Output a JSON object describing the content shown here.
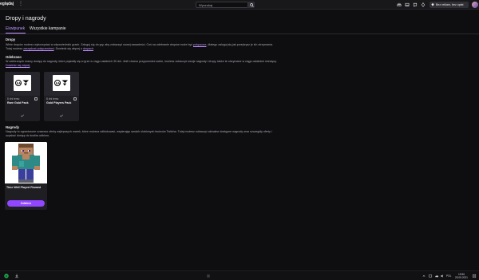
{
  "topbar": {
    "brand": "eglądaj",
    "more_symbol": "⋮",
    "search_placeholder": "Wyszukaj",
    "turbo_label": "Bez reklam, bez opłat"
  },
  "page": {
    "title": "Dropy i nagrody",
    "tabs": [
      {
        "label": "Ekwipunek",
        "active": true
      },
      {
        "label": "Wszystkie kampanie",
        "active": false
      }
    ]
  },
  "drops": {
    "title": "Dropy",
    "text1": "Wiele dropów możesz wykorzystać w odpowiednich grach. Zaloguj się do gry, aby zobaczyć nowej zawartości. Coś na odebranie dropów może być ",
    "link1": "połączone",
    "text2": ", dlatego zaloguj się jak przejrzysz je ich otrzymania. Tutaj możesz ",
    "link2": "zarządzać połączeniami",
    "text3": ". Dowiedz się więcej o ",
    "link3": "dropach",
    "text4": "."
  },
  "received": {
    "title": "Odebrano",
    "text1": "W odebranych mamy dostęp do nagrody, które pojawiły się w grze w ciągu ostatnich 30 dni. Jeśli chcesz przypomnieć sobie, możesz zobaczyć swoje nagrody i dropy, także te otrzymane w ciągu ostatnich miesięcy. ",
    "link": "Dowiedz się więcej",
    "text2": ".",
    "items": [
      {
        "count": "8 dni temu",
        "name": "Rare Gold Pack",
        "info": "i"
      },
      {
        "count": "8 dni temu",
        "name": "Gold Players Pack",
        "info": "i"
      }
    ]
  },
  "rewards": {
    "title": "Nagrody",
    "text": "Nagrody to ograniczone czasowo oferty najlepszych marek, które możesz odblokować, wspierając swoich ulubionych twórców Twitcha. Tutaj możesz zobaczyć aktualne dostępne nagrody oraz szczegóły oferty i uzyskać dostęp do kodów odbioru.",
    "item": {
      "name": "Time Well Played Reward",
      "button": "Odbierz"
    }
  },
  "taskbar": {
    "tray_lang": "POL",
    "time": "19:56",
    "date": "25.05.2021"
  },
  "colors": {
    "accent": "#9147ff",
    "accent_text": "#bf94ff",
    "background": "#0e0e10"
  }
}
